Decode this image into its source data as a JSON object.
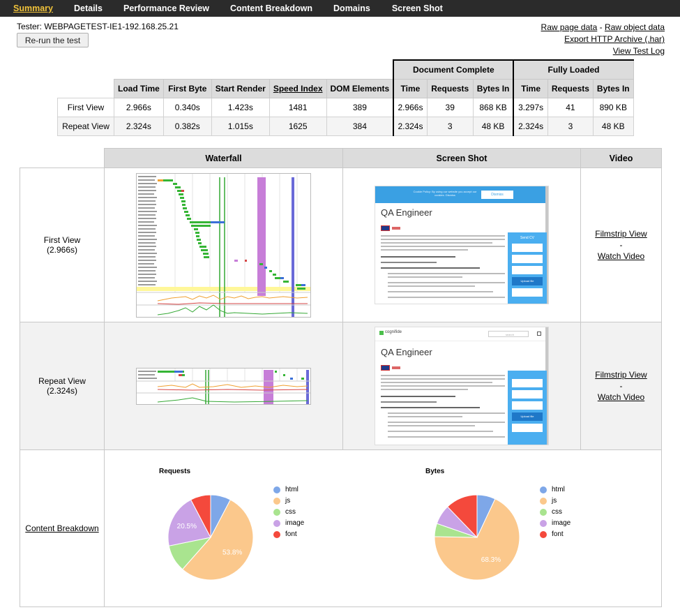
{
  "nav": {
    "items": [
      {
        "label": "Summary",
        "active": true
      },
      {
        "label": "Details",
        "active": false
      },
      {
        "label": "Performance Review",
        "active": false
      },
      {
        "label": "Content Breakdown",
        "active": false
      },
      {
        "label": "Domains",
        "active": false
      },
      {
        "label": "Screen Shot",
        "active": false
      }
    ]
  },
  "tester": "Tester: WEBPAGETEST-IE1-192.168.25.21",
  "rerun_label": "Re-run the test",
  "links": {
    "raw_page": "Raw page data",
    "sep": " - ",
    "raw_object": "Raw object data",
    "export_har": "Export HTTP Archive (.har)",
    "view_log": "View Test Log"
  },
  "summary": {
    "group_headers": {
      "document_complete": "Document Complete",
      "fully_loaded": "Fully Loaded"
    },
    "columns": [
      "Load Time",
      "First Byte",
      "Start Render",
      "Speed Index",
      "DOM Elements",
      "Time",
      "Requests",
      "Bytes In",
      "Time",
      "Requests",
      "Bytes In"
    ],
    "rows": [
      {
        "label": "First View",
        "values": [
          "2.966s",
          "0.340s",
          "1.423s",
          "1481",
          "389",
          "2.966s",
          "39",
          "868 KB",
          "3.297s",
          "41",
          "890 KB"
        ]
      },
      {
        "label": "Repeat View",
        "values": [
          "2.324s",
          "0.382s",
          "1.015s",
          "1625",
          "384",
          "2.324s",
          "3",
          "48 KB",
          "2.324s",
          "3",
          "48 KB"
        ]
      }
    ]
  },
  "media": {
    "headers": {
      "waterfall": "Waterfall",
      "screenshot": "Screen Shot",
      "video": "Video"
    },
    "first_view": {
      "label": "First View",
      "time": "(2.966s)"
    },
    "repeat_view": {
      "label": "Repeat View",
      "time": "(2.324s)"
    },
    "filmstrip": "Filmstrip View",
    "dash": "-",
    "watch": "Watch Video",
    "content_breakdown": "Content Breakdown",
    "shot1": {
      "banner": "Cookie Policy: By using our website you accept our cookies. Dismiss",
      "banner_button": "Dismiss",
      "title": "QA Engineer",
      "sidebar_title": "Send CV",
      "sidebar_button": "Upload file"
    },
    "shot2": {
      "logo": "cognifide",
      "search": "search",
      "title": "QA Engineer",
      "sidebar_button": "Upload file"
    }
  },
  "colors": {
    "html": "#7ea7e8",
    "js": "#fbc88c",
    "css": "#a9e48f",
    "image": "#c9a2e6",
    "font": "#f4493c"
  },
  "chart_data": [
    {
      "type": "pie",
      "title": "Requests",
      "categories": [
        "html",
        "js",
        "css",
        "image",
        "font"
      ],
      "values": [
        7.7,
        53.8,
        10.3,
        20.5,
        7.7
      ],
      "labels": {
        "js": "53.8%",
        "image": "20.5%"
      }
    },
    {
      "type": "pie",
      "title": "Bytes",
      "categories": [
        "html",
        "js",
        "css",
        "image",
        "font"
      ],
      "values": [
        7.0,
        68.3,
        5.0,
        7.5,
        12.2
      ],
      "labels": {
        "js": "68.3%"
      }
    }
  ]
}
